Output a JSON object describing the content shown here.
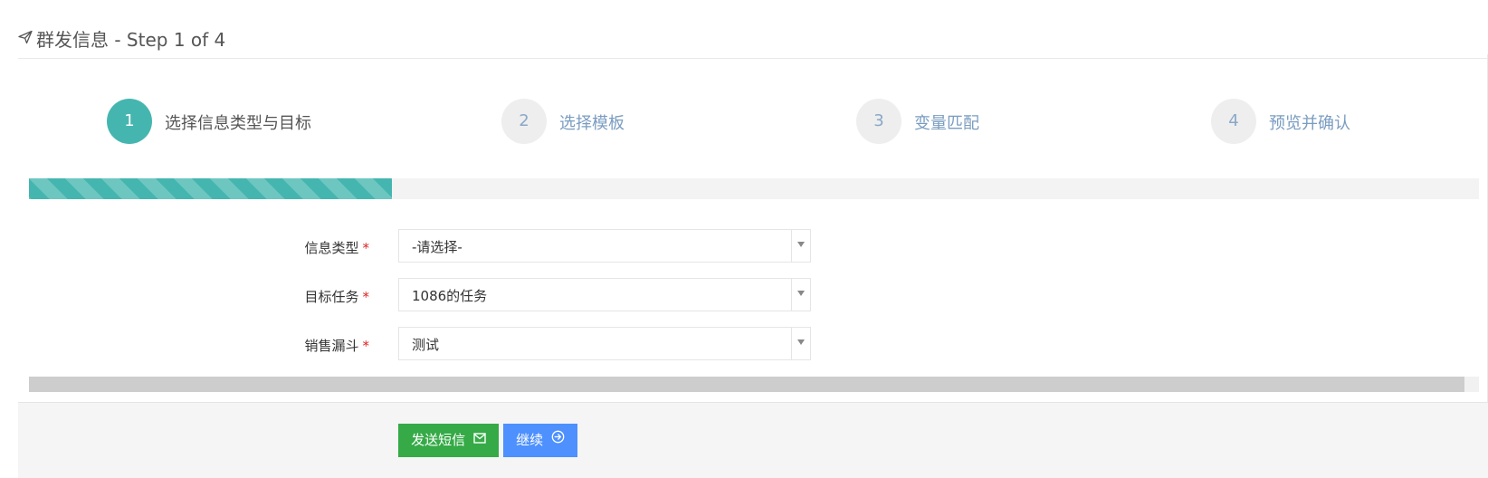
{
  "header": {
    "title": "群发信息 - Step 1 of 4",
    "icon": "send-icon"
  },
  "steps": [
    {
      "number": "1",
      "label": "选择信息类型与目标",
      "active": true
    },
    {
      "number": "2",
      "label": "选择模板",
      "active": false
    },
    {
      "number": "3",
      "label": "变量匹配",
      "active": false
    },
    {
      "number": "4",
      "label": "预览并确认",
      "active": false
    }
  ],
  "progress": {
    "percent": 25,
    "color": "#45b6af"
  },
  "form": {
    "fields": [
      {
        "label": "信息类型",
        "required_mark": "*",
        "value": "-请选择-"
      },
      {
        "label": "目标任务",
        "required_mark": "*",
        "value": "1086的任务"
      },
      {
        "label": "销售漏斗",
        "required_mark": "*",
        "value": "测试"
      }
    ]
  },
  "buttons": {
    "send_sms": {
      "label": "发送短信",
      "icon": "envelope-icon",
      "color": "#35aa47"
    },
    "continue": {
      "label": "继续",
      "icon": "arrow-circle-right-icon",
      "color": "#4d90fe"
    }
  },
  "colors": {
    "accent": "#45b6af",
    "required": "#e02222",
    "step_label_inactive": "#7a9cc0"
  }
}
